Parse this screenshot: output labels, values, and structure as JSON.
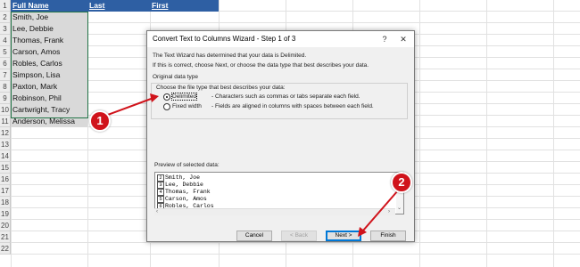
{
  "spreadsheet": {
    "headers": {
      "a": "Full Name",
      "b": "Last",
      "c": "First"
    },
    "row_numbers": [
      "1",
      "2",
      "3",
      "4",
      "5",
      "6",
      "7",
      "8",
      "9",
      "10",
      "11",
      "12",
      "13",
      "14",
      "15",
      "16",
      "17",
      "18",
      "19",
      "20",
      "21",
      "22"
    ],
    "names": [
      "Smith, Joe",
      "Lee, Debbie",
      "Thomas, Frank",
      "Carson, Amos",
      "Robles, Carlos",
      "Simpson, Lisa",
      "Paxton, Mark",
      "Robinson, Phil",
      "Cartwright, Tracy",
      "Anderson, Melissa"
    ],
    "colors": {
      "header_fill": "#2e5fa3",
      "selection_fill": "#d9d9d9",
      "selection_border": "#217346"
    }
  },
  "dialog": {
    "title": "Convert Text to Columns Wizard - Step 1 of 3",
    "help_label": "?",
    "close_label": "✕",
    "intro_line1": "The Text Wizard has determined that your data is Delimited.",
    "intro_line2": "If this is correct, choose Next, or choose the data type that best describes your data.",
    "group_title": "Original data type",
    "group_prompt": "Choose the file type that best describes your data:",
    "option_delimited": {
      "label": "Delimited",
      "desc": "- Characters such as commas or tabs separate each field.",
      "selected": true
    },
    "option_fixed": {
      "label": "Fixed width",
      "desc": "- Fields are aligned in columns with spaces between each field.",
      "selected": false
    },
    "preview_label": "Preview of selected data:",
    "preview_rows": [
      {
        "num": "2",
        "text": "Smith, Joe"
      },
      {
        "num": "3",
        "text": "Lee, Debbie"
      },
      {
        "num": "4",
        "text": "Thomas, Frank"
      },
      {
        "num": "5",
        "text": "Carson, Amos"
      },
      {
        "num": "6",
        "text": "Robles, Carlos"
      }
    ],
    "buttons": {
      "cancel": "Cancel",
      "back": "< Back",
      "next": "Next >",
      "finish": "Finish"
    }
  },
  "callouts": {
    "one": "1",
    "two": "2",
    "color": "#d0131b"
  }
}
